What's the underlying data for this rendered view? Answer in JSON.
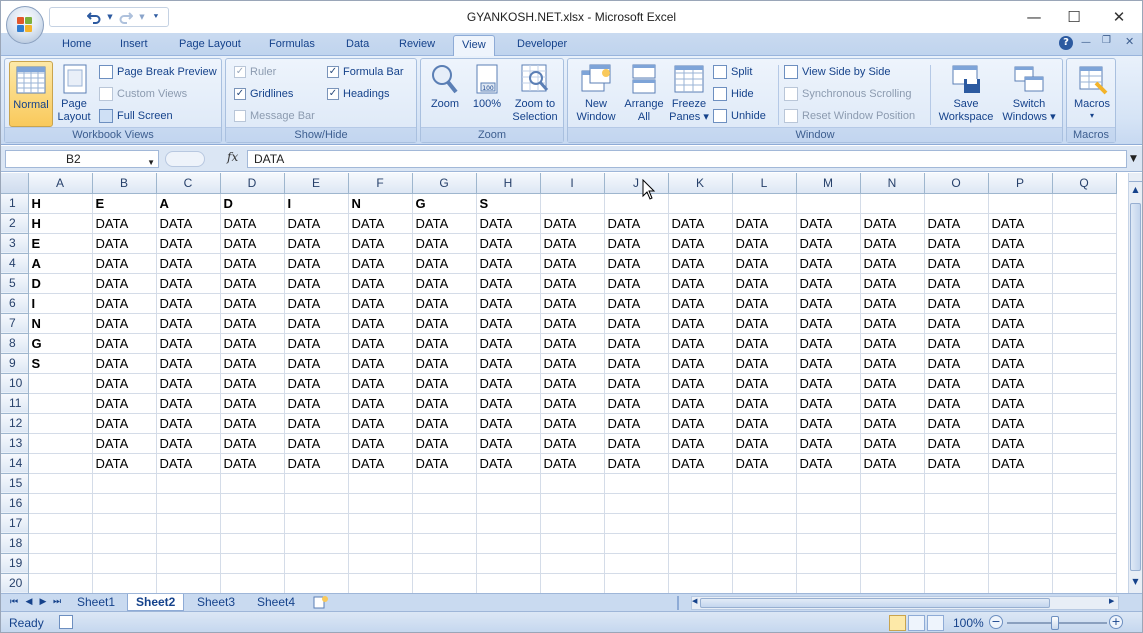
{
  "window": {
    "title": "GYANKOSH.NET.xlsx - Microsoft Excel",
    "minimize_glyph": "—",
    "maximize_glyph": "☐",
    "close_glyph": "✕"
  },
  "qat": {
    "save_icon": "save-icon",
    "undo_icon": "undo-icon",
    "redo_icon": "redo-icon",
    "customize_icon": "customize-qat-icon"
  },
  "tabs": [
    "Home",
    "Insert",
    "Page Layout",
    "Formulas",
    "Data",
    "Review",
    "View",
    "Developer"
  ],
  "active_tab": "View",
  "ribbon": {
    "workbook_views": {
      "label": "Workbook Views",
      "normal": "Normal",
      "page_layout_1": "Page",
      "page_layout_2": "Layout",
      "page_break_preview": "Page Break Preview",
      "custom_views": "Custom Views",
      "full_screen": "Full Screen"
    },
    "show_hide": {
      "label": "Show/Hide",
      "ruler": "Ruler",
      "gridlines": "Gridlines",
      "message_bar": "Message Bar",
      "formula_bar": "Formula Bar",
      "headings": "Headings",
      "ruler_checked": true,
      "gridlines_checked": true,
      "message_bar_checked": false,
      "formula_bar_checked": true,
      "headings_checked": true
    },
    "zoom": {
      "label": "Zoom",
      "zoom": "Zoom",
      "hundred": "100%",
      "zoom_to_1": "Zoom to",
      "zoom_to_2": "Selection"
    },
    "window": {
      "label": "Window",
      "new_1": "New",
      "new_2": "Window",
      "arrange_1": "Arrange",
      "arrange_2": "All",
      "freeze_1": "Freeze",
      "freeze_2": "Panes ▾",
      "split": "Split",
      "hide": "Hide",
      "unhide": "Unhide",
      "view_side": "View Side by Side",
      "sync_scroll": "Synchronous Scrolling",
      "reset_pos": "Reset Window Position",
      "save_1": "Save",
      "save_2": "Workspace",
      "switch_1": "Switch",
      "switch_2": "Windows ▾"
    },
    "macros": {
      "label": "Macros",
      "macros": "Macros",
      "arrow": "▾"
    }
  },
  "formula_bar": {
    "name_box": "B2",
    "fx": "fx",
    "value": "DATA"
  },
  "grid": {
    "columns": [
      "A",
      "B",
      "C",
      "D",
      "E",
      "F",
      "G",
      "H",
      "I",
      "J",
      "K",
      "L",
      "M",
      "N",
      "O",
      "P",
      "Q"
    ],
    "rows": [
      [
        "H",
        "E",
        "A",
        "D",
        "I",
        "N",
        "G",
        "S",
        "",
        "",
        "",
        "",
        "",
        "",
        "",
        "",
        ""
      ],
      [
        "H",
        "DATA",
        "DATA",
        "DATA",
        "DATA",
        "DATA",
        "DATA",
        "DATA",
        "DATA",
        "DATA",
        "DATA",
        "DATA",
        "DATA",
        "DATA",
        "DATA",
        "DATA",
        ""
      ],
      [
        "E",
        "DATA",
        "DATA",
        "DATA",
        "DATA",
        "DATA",
        "DATA",
        "DATA",
        "DATA",
        "DATA",
        "DATA",
        "DATA",
        "DATA",
        "DATA",
        "DATA",
        "DATA",
        ""
      ],
      [
        "A",
        "DATA",
        "DATA",
        "DATA",
        "DATA",
        "DATA",
        "DATA",
        "DATA",
        "DATA",
        "DATA",
        "DATA",
        "DATA",
        "DATA",
        "DATA",
        "DATA",
        "DATA",
        ""
      ],
      [
        "D",
        "DATA",
        "DATA",
        "DATA",
        "DATA",
        "DATA",
        "DATA",
        "DATA",
        "DATA",
        "DATA",
        "DATA",
        "DATA",
        "DATA",
        "DATA",
        "DATA",
        "DATA",
        ""
      ],
      [
        "I",
        "DATA",
        "DATA",
        "DATA",
        "DATA",
        "DATA",
        "DATA",
        "DATA",
        "DATA",
        "DATA",
        "DATA",
        "DATA",
        "DATA",
        "DATA",
        "DATA",
        "DATA",
        ""
      ],
      [
        "N",
        "DATA",
        "DATA",
        "DATA",
        "DATA",
        "DATA",
        "DATA",
        "DATA",
        "DATA",
        "DATA",
        "DATA",
        "DATA",
        "DATA",
        "DATA",
        "DATA",
        "DATA",
        ""
      ],
      [
        "G",
        "DATA",
        "DATA",
        "DATA",
        "DATA",
        "DATA",
        "DATA",
        "DATA",
        "DATA",
        "DATA",
        "DATA",
        "DATA",
        "DATA",
        "DATA",
        "DATA",
        "DATA",
        ""
      ],
      [
        "S",
        "DATA",
        "DATA",
        "DATA",
        "DATA",
        "DATA",
        "DATA",
        "DATA",
        "DATA",
        "DATA",
        "DATA",
        "DATA",
        "DATA",
        "DATA",
        "DATA",
        "DATA",
        ""
      ],
      [
        "",
        "DATA",
        "DATA",
        "DATA",
        "DATA",
        "DATA",
        "DATA",
        "DATA",
        "DATA",
        "DATA",
        "DATA",
        "DATA",
        "DATA",
        "DATA",
        "DATA",
        "DATA",
        ""
      ],
      [
        "",
        "DATA",
        "DATA",
        "DATA",
        "DATA",
        "DATA",
        "DATA",
        "DATA",
        "DATA",
        "DATA",
        "DATA",
        "DATA",
        "DATA",
        "DATA",
        "DATA",
        "DATA",
        ""
      ],
      [
        "",
        "DATA",
        "DATA",
        "DATA",
        "DATA",
        "DATA",
        "DATA",
        "DATA",
        "DATA",
        "DATA",
        "DATA",
        "DATA",
        "DATA",
        "DATA",
        "DATA",
        "DATA",
        ""
      ],
      [
        "",
        "DATA",
        "DATA",
        "DATA",
        "DATA",
        "DATA",
        "DATA",
        "DATA",
        "DATA",
        "DATA",
        "DATA",
        "DATA",
        "DATA",
        "DATA",
        "DATA",
        "DATA",
        ""
      ],
      [
        "",
        "DATA",
        "DATA",
        "DATA",
        "DATA",
        "DATA",
        "DATA",
        "DATA",
        "DATA",
        "DATA",
        "DATA",
        "DATA",
        "DATA",
        "DATA",
        "DATA",
        "DATA",
        ""
      ],
      [
        "",
        "",
        "",
        "",
        "",
        "",
        "",
        "",
        "",
        "",
        "",
        "",
        "",
        "",
        "",
        "",
        ""
      ],
      [
        "",
        "",
        "",
        "",
        "",
        "",
        "",
        "",
        "",
        "",
        "",
        "",
        "",
        "",
        "",
        "",
        ""
      ],
      [
        "",
        "",
        "",
        "",
        "",
        "",
        "",
        "",
        "",
        "",
        "",
        "",
        "",
        "",
        "",
        "",
        ""
      ],
      [
        "",
        "",
        "",
        "",
        "",
        "",
        "",
        "",
        "",
        "",
        "",
        "",
        "",
        "",
        "",
        "",
        ""
      ],
      [
        "",
        "",
        "",
        "",
        "",
        "",
        "",
        "",
        "",
        "",
        "",
        "",
        "",
        "",
        "",
        "",
        ""
      ],
      [
        "",
        "",
        "",
        "",
        "",
        "",
        "",
        "",
        "",
        "",
        "",
        "",
        "",
        "",
        "",
        "",
        ""
      ]
    ]
  },
  "sheets": [
    "Sheet1",
    "Sheet2",
    "Sheet3",
    "Sheet4"
  ],
  "active_sheet": "Sheet2",
  "status": {
    "text": "Ready",
    "zoom": "100%",
    "zoom_out": "−",
    "zoom_in": "+"
  },
  "colors": {
    "ribbon_blue": "#c9daf0",
    "selection_gold": "#f9c95b",
    "header_blue": "#dde7f4"
  }
}
